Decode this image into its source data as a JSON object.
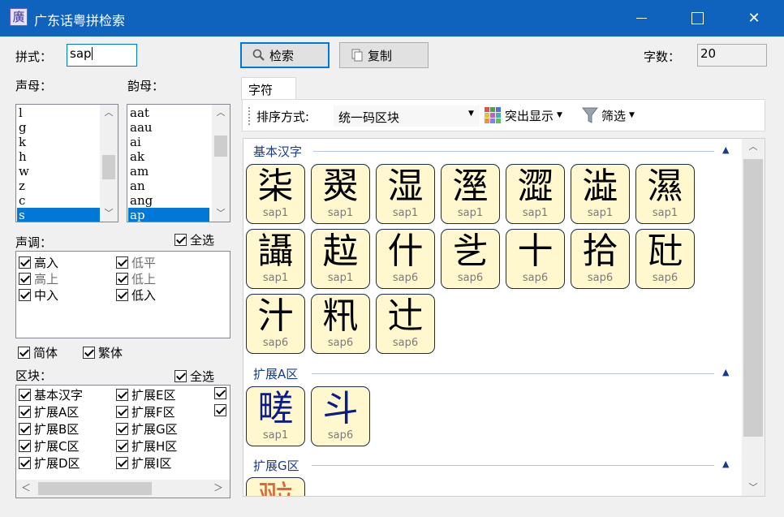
{
  "window": {
    "title": "广东话粤拼检索",
    "icon_char": "廣"
  },
  "form": {
    "pinyin_label": "拼式：",
    "pinyin_value": "sap",
    "search_button": "检索",
    "copy_button": "复制",
    "count_label": "字数：",
    "count_value": "20"
  },
  "initials": {
    "label": "声母：",
    "items": [
      "l",
      "g",
      "k",
      "h",
      "w",
      "z",
      "c",
      "s"
    ],
    "selected": "s"
  },
  "finals": {
    "label": "韵母：",
    "items": [
      "aat",
      "aau",
      "ai",
      "ak",
      "am",
      "an",
      "ang",
      "ap"
    ],
    "selected": "ap"
  },
  "tones": {
    "label": "声调：",
    "select_all": "全选",
    "items": [
      {
        "label": "高入",
        "checked": true,
        "enabled": true
      },
      {
        "label": "低平",
        "checked": true,
        "enabled": false
      },
      {
        "label": "高上",
        "checked": true,
        "enabled": false
      },
      {
        "label": "低上",
        "checked": true,
        "enabled": false
      },
      {
        "label": "中入",
        "checked": true,
        "enabled": true
      },
      {
        "label": "低入",
        "checked": true,
        "enabled": true
      }
    ]
  },
  "scripts": {
    "simplified": "简体",
    "traditional": "繁体"
  },
  "blocks": {
    "label": "区块：",
    "select_all": "全选",
    "items": [
      "基本汉字",
      "扩展A区",
      "扩展B区",
      "扩展C区",
      "扩展D区",
      "扩展E区",
      "扩展F区",
      "扩展G区",
      "扩展H区",
      "扩展I区"
    ]
  },
  "tabs": {
    "characters": "字符"
  },
  "toolbar": {
    "sort_label": "排序方式:",
    "sort_value": "统一码区块",
    "highlight": "突出显示",
    "filter": "筛选"
  },
  "groups": {
    "basic": {
      "title": "基本汉字",
      "chars": [
        {
          "char": "柒",
          "reading": "sap1"
        },
        {
          "char": "翜",
          "reading": "sap1"
        },
        {
          "char": "湿",
          "reading": "sap1"
        },
        {
          "char": "溼",
          "reading": "sap1"
        },
        {
          "char": "澀",
          "reading": "sap1"
        },
        {
          "char": "澁",
          "reading": "sap1"
        },
        {
          "char": "濕",
          "reading": "sap1"
        },
        {
          "char": "讘",
          "reading": "sap1"
        },
        {
          "char": "趇",
          "reading": "sap1"
        },
        {
          "char": "什",
          "reading": "sap6"
        },
        {
          "char": "乧",
          "reading": "sap6"
        },
        {
          "char": "十",
          "reading": "sap6"
        },
        {
          "char": "拾",
          "reading": "sap6"
        },
        {
          "char": "瓧",
          "reading": "sap6"
        },
        {
          "char": "汁",
          "reading": "sap6"
        },
        {
          "char": "籸",
          "reading": "sap6"
        },
        {
          "char": "辻",
          "reading": "sap6"
        }
      ]
    },
    "extA": {
      "title": "扩展A区",
      "chars": [
        {
          "char": "㽨",
          "reading": "sap1"
        },
        {
          "char": "斗",
          "reading": "sap6"
        }
      ]
    },
    "extG": {
      "title": "扩展G区",
      "chars": [
        {
          "char": "翋",
          "reading": ""
        }
      ]
    }
  },
  "colors": {
    "titlebar": "#0f63bd",
    "selection": "#0078d7",
    "tile_bg": "#fff8cf",
    "group_title": "#1a3b8a"
  }
}
